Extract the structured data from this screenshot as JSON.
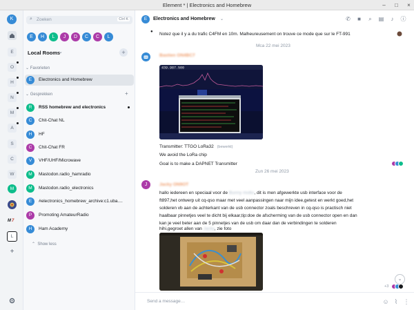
{
  "window": {
    "title": "Element * | Electronics and Homebrew",
    "minimize": "–",
    "maximize": "□",
    "close": "×"
  },
  "colors": {
    "accent": "#0dbd8b",
    "purple": "#ac3ba8",
    "blue": "#368bd6",
    "orange": "#f0a070"
  },
  "rail": {
    "home_letter": "K",
    "items": [
      {
        "label": "E",
        "unread": false
      },
      {
        "label": "O",
        "unread": true
      },
      {
        "label": "H",
        "unread": true
      },
      {
        "label": "N",
        "unread": true
      },
      {
        "label": "M",
        "unread": true
      },
      {
        "label": "A",
        "unread": true
      },
      {
        "label": "S",
        "unread": false
      },
      {
        "label": "C",
        "unread": false
      },
      {
        "label": "W",
        "unread": false
      },
      {
        "label": "M"
      },
      {
        "label": "L",
        "selected": true
      }
    ],
    "add": "+"
  },
  "roomlist": {
    "search_placeholder": "Zoeken",
    "search_shortcut": "Ctrl K",
    "people": [
      "E",
      "H",
      "L",
      "J",
      "D",
      "C",
      "C",
      "L"
    ],
    "title": "Local Rooms",
    "add_button": "+",
    "favorites_label": "Favorieten",
    "conversations_label": "Gesprekken",
    "favorites": [
      {
        "letter": "E",
        "name": "Electronics and Homebrew",
        "color": "#368bd6",
        "selected": true
      }
    ],
    "rooms": [
      {
        "letter": "R",
        "name": "RSS homebrew and electronics",
        "color": "#0dbd8b",
        "bold": true,
        "unread": true
      },
      {
        "letter": "C",
        "name": "Chit-Chat NL",
        "color": "#368bd6"
      },
      {
        "letter": "H",
        "name": "HF",
        "color": "#368bd6"
      },
      {
        "letter": "C",
        "name": "Chit-Chat FR",
        "color": "#ac3ba8"
      },
      {
        "letter": "V",
        "name": "VHF/UHF/Microwave",
        "color": "#368bd6"
      },
      {
        "letter": "M",
        "name": "Mastodon.radio_hamradio",
        "color": "#0dbd8b"
      },
      {
        "letter": "M",
        "name": "Mastodon.radio_electronics",
        "color": "#0dbd8b"
      },
      {
        "letter": "E",
        "name": "#electronics_homebrew_archive:c1.uba....",
        "color": "#368bd6"
      },
      {
        "letter": "P",
        "name": "Promoting AmateurRadio",
        "color": "#ac3ba8"
      },
      {
        "letter": "H",
        "name": "Ham Academy",
        "color": "#368bd6"
      }
    ],
    "show_less": "Show less"
  },
  "main": {
    "room_letter": "E",
    "room_name": "Electronics and Homebrew",
    "message_top": "Notez que il y a du trafic C4FM en 10m. Malheureusement on trouve ce mode que sur le FT-991",
    "date1": "Mca 22 mei 2023",
    "msg2": {
      "sender": "Bastien ON4BC7",
      "caption": "Transmitter: TTGO LoRa32",
      "edited": "(bewerkt)",
      "line2": "We avoid the LoRa chip",
      "line3": "Goal is to make a DAPNET Transmitter",
      "freq": "439.987.500"
    },
    "date2": "Zun 26 mei 2023",
    "msg3": {
      "avatar": "J",
      "sender": "Jacky ON9OT",
      "l1a": "hallo iedereen en speciaal voor de",
      "l1_blur": "Bunny motto",
      "l1b": ", dit is men afgewerkte usb interface voor de",
      "l2": "ft897,het ontwerp uit cq-qso maar met veel aanpassingen naar mijn idee,getest en werkt goed,het",
      "l3": "solderen vb aan de achterkant van de usb connector zoals beschreven in cq-qso is practisch niet",
      "l4": "haalbaar pinnetjes veel te dicht bij elkaar,tip:doe de afscherming van de usb connector open en dan",
      "l5": "kan je veel beter aan de 5 pinnetjes van de usb om daar dan de verbindingen te solderen",
      "l6a": "hihi,gegroet allen van",
      "l6_blur": "Jacky",
      "l6b": ", zie foto"
    },
    "readers_count": "+3",
    "composer_placeholder": "Send a message…"
  }
}
